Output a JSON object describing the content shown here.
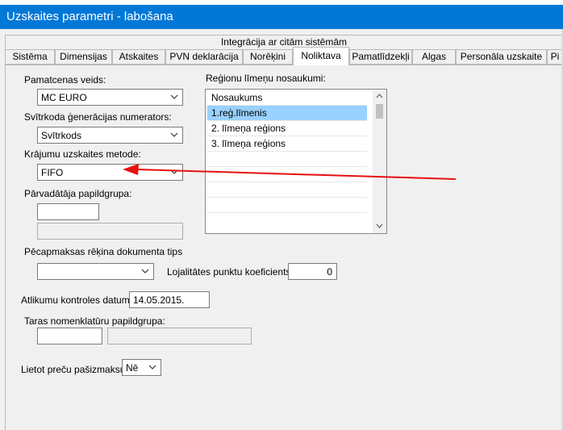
{
  "window": {
    "title": "Uzskaites parametri - labošana"
  },
  "tabs": {
    "upper": "Integrācija ar citām sistēmām",
    "lower": [
      "Sistēma",
      "Dimensijas",
      "Atskaites",
      "PVN deklarācija",
      "Norēķini",
      "Noliktava",
      "Pamatlīdzekļi",
      "Algas",
      "Personāla uzskaite",
      "Pi"
    ],
    "active": "Noliktava"
  },
  "form": {
    "price_type_label": "Pamatcenas veids:",
    "price_type_value": "MC EURO",
    "barcode_label": "Svītrkoda ģenerācijas numerators:",
    "barcode_value": "Svītrkods",
    "inventory_method_label": "Krājumu uzskaites metode:",
    "inventory_method_value": "FIFO",
    "carrier_group_label": "Pārvadātāja papildgrupa:",
    "carrier_group_value": "",
    "prepay_label": "Pēcapmaksas rēķina dokumenta tips",
    "prepay_value": "",
    "loyalty_label": "Lojalitātes punktu koeficients:",
    "loyalty_value": "0",
    "balance_date_label": "Atlikumu kontroles datums:",
    "balance_date_value": "14.05.2015.",
    "tare_group_label": "Taras nomenklatūru papildgrupa:",
    "tare_group_value": "",
    "use_sign_label": "Lietot preču pašizmaksu:",
    "use_sign_value": "Nē"
  },
  "regions": {
    "label": "Reģionu līmeņu nosaukumi:",
    "header": "Nosaukums",
    "rows": [
      "1.reģ.līmenis",
      "2. līmeņa reģions",
      "3. līmeņa reģions"
    ],
    "selected_index": 0
  },
  "annotation": {
    "color": "#e81010"
  }
}
